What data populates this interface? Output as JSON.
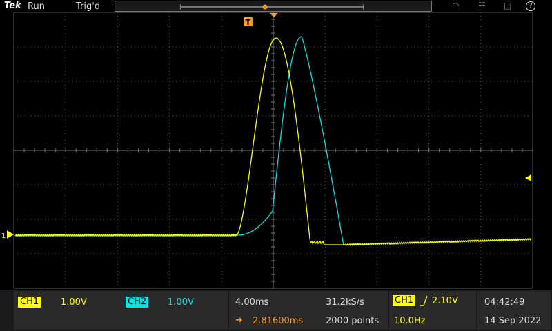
{
  "topbar": {
    "brand": "Tek",
    "run_status": "Run",
    "trigger_status": "Trig'd"
  },
  "scope": {
    "trigger_marker": "T",
    "ch1_marker": "1"
  },
  "channels": {
    "ch1": {
      "label": "CH1",
      "scale": "1.00V",
      "color": "#ffff00"
    },
    "ch2": {
      "label": "CH2",
      "scale": "1.00V",
      "color": "#00e5e5"
    }
  },
  "horizontal": {
    "timebase": "4.00ms",
    "sample_rate": "31.2kS/s",
    "position": "2.81600ms",
    "record_length": "2000 points"
  },
  "trigger": {
    "source": "CH1",
    "level": "2.10V",
    "frequency": "10.0Hz"
  },
  "clock": {
    "time": "04:42:49",
    "date": "14 Sep 2022"
  },
  "colors": {
    "ch1": "#ffff00",
    "ch2": "#00e5e5",
    "trigger_accent": "#ff9a1a",
    "grid": "#555555"
  },
  "icons": [
    "wifi-icon",
    "network-icon",
    "save-icon",
    "help-icon",
    "trigger-slope-rising-icon",
    "horizontal-position-arrow-icon"
  ]
}
